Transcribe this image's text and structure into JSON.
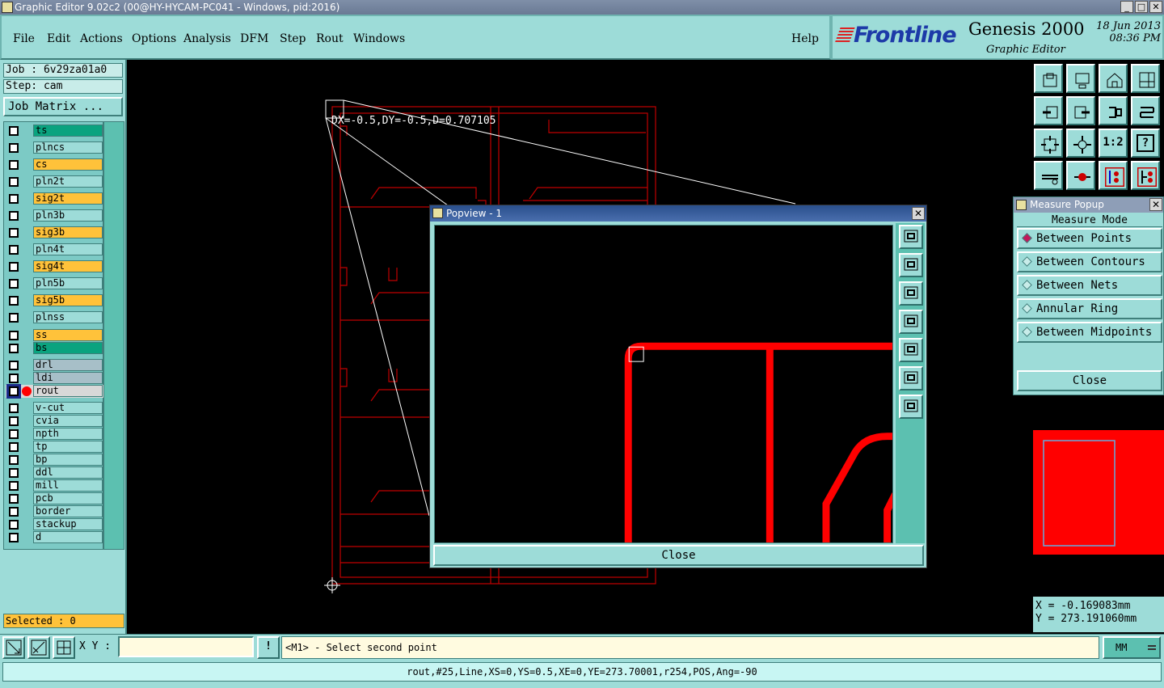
{
  "window": {
    "title": "Graphic Editor 9.02c2 (00@HY-HYCAM-PC041 - Windows, pid:2016)"
  },
  "menu": [
    {
      "key": "file",
      "label": "File"
    },
    {
      "key": "edit",
      "label": "Edit"
    },
    {
      "key": "actions",
      "label": "Actions"
    },
    {
      "key": "options",
      "label": "Options"
    },
    {
      "key": "analysis",
      "label": "Analysis"
    },
    {
      "key": "dfm",
      "label": "DFM"
    },
    {
      "key": "step",
      "label": "Step"
    },
    {
      "key": "rout",
      "label": "Rout"
    },
    {
      "key": "windows",
      "label": "Windows"
    }
  ],
  "help_label": "Help",
  "brand": {
    "logo": "Frontline",
    "product": "Genesis 2000",
    "subtitle": "Graphic Editor",
    "date": "18 Jun 2013",
    "time": "08:36 PM"
  },
  "job": {
    "job_label": "Job : 6v29za01a0",
    "step_label": "Step: cam",
    "matrix_button": "Job Matrix ..."
  },
  "colors": {
    "signal": "#ffc23a",
    "mask": "#0aa37f",
    "plane": "#9ddcd8",
    "drill": "#a7bfc8",
    "rout_row": "#d8d8d8",
    "rout_marker": "#ff0000",
    "graphics": "#ff0000",
    "outline": "#c00000"
  },
  "layers": [
    {
      "name": "ts",
      "type": "mask"
    },
    {
      "name": "plncs",
      "type": "plane"
    },
    {
      "name": "cs",
      "type": "signal"
    },
    {
      "name": "pln2t",
      "type": "plane"
    },
    {
      "name": "sig2t",
      "type": "signal"
    },
    {
      "name": "pln3b",
      "type": "plane"
    },
    {
      "name": "sig3b",
      "type": "signal"
    },
    {
      "name": "pln4t",
      "type": "plane"
    },
    {
      "name": "sig4t",
      "type": "signal"
    },
    {
      "name": "pln5b",
      "type": "plane"
    },
    {
      "name": "sig5b",
      "type": "signal"
    },
    {
      "name": "plnss",
      "type": "plane"
    },
    {
      "name": "ss",
      "type": "signal"
    },
    {
      "name": "bs",
      "type": "mask"
    },
    {
      "name": "drl",
      "type": "drill"
    },
    {
      "name": "ldi",
      "type": "drill"
    },
    {
      "name": "rout",
      "type": "rout",
      "active": true
    },
    {
      "name": "v-cut",
      "type": "plane"
    },
    {
      "name": "cvia",
      "type": "plane"
    },
    {
      "name": "npth",
      "type": "plane"
    },
    {
      "name": "tp",
      "type": "plane"
    },
    {
      "name": "bp",
      "type": "plane"
    },
    {
      "name": "ddl",
      "type": "plane"
    },
    {
      "name": "mill",
      "type": "plane"
    },
    {
      "name": "pcb",
      "type": "plane"
    },
    {
      "name": "border",
      "type": "plane"
    },
    {
      "name": "stackup",
      "type": "plane"
    },
    {
      "name": "d",
      "type": "plane"
    }
  ],
  "selected_label": "Selected : 0",
  "canvas": {
    "measure_text": "DX=-0.5,DY=-0.5,D=0.707105"
  },
  "popview": {
    "title": "Popview - 1",
    "close_label": "Close"
  },
  "measure_popup": {
    "title": "Measure Popup",
    "mode_label": "Measure Mode",
    "options": [
      {
        "label": "Between Points",
        "selected": true
      },
      {
        "label": "Between Contours",
        "selected": false
      },
      {
        "label": "Between Nets",
        "selected": false
      },
      {
        "label": "Annular Ring",
        "selected": false
      },
      {
        "label": "Between Midpoints",
        "selected": false
      }
    ],
    "close_label": "Close"
  },
  "toolbar_icons": [
    "zoom-home-icon",
    "zoom-previous-icon",
    "home-icon",
    "window-icon",
    "pan-left-icon",
    "pan-right-icon",
    "rotate-icon",
    "snap-icon",
    "fit-icon",
    "center-icon",
    "scale-1to2-icon",
    "help-icon",
    "measure-icon",
    "probe-icon",
    "net-highlight-icon",
    "layer-compare-icon"
  ],
  "toolbar_texts": {
    "scale": "1:2",
    "help": "?"
  },
  "coords": {
    "x": "X = -0.169083mm",
    "y": "Y = 273.191060mm"
  },
  "command": {
    "xy_label": "X Y :",
    "xy_value": "",
    "prompt": "<M1> - Select second point",
    "units": "MM",
    "excl": "!"
  },
  "status": "rout,#25,Line,XS=0,YS=0.5,XE=0,YE=273.70001,r254,POS,Ang=-90"
}
